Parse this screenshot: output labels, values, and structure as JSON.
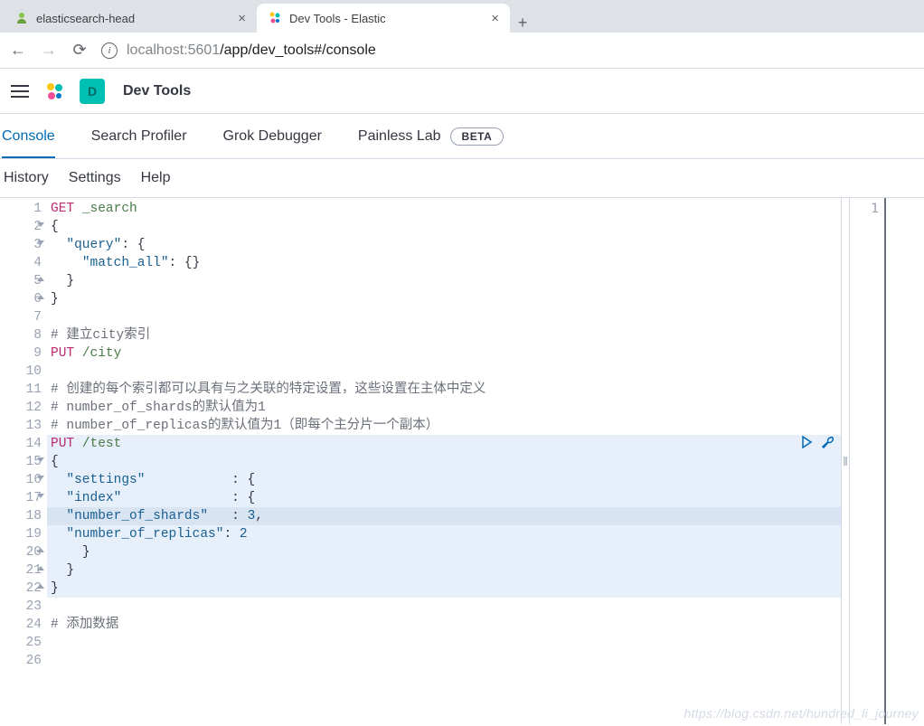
{
  "browser": {
    "tabs": [
      {
        "title": "elasticsearch-head",
        "active": false
      },
      {
        "title": "Dev Tools - Elastic",
        "active": true
      }
    ],
    "url_host_dim1": "localhost",
    "url_port": ":5601",
    "url_path": "/app/dev_tools#/console"
  },
  "header": {
    "user_initial": "D",
    "app_title": "Dev Tools"
  },
  "devtools_tabs": {
    "console": "Console",
    "profiler": "Search Profiler",
    "grok": "Grok Debugger",
    "painless": "Painless Lab",
    "beta": "BETA"
  },
  "subbar": {
    "history": "History",
    "settings": "Settings",
    "help": "Help"
  },
  "editor": {
    "lines": [
      {
        "n": "1",
        "fold": "",
        "tokens": [
          [
            "method",
            "GET"
          ],
          [
            "text",
            " "
          ],
          [
            "path",
            "_search"
          ]
        ]
      },
      {
        "n": "2",
        "fold": "open",
        "tokens": [
          [
            "punc",
            "{"
          ]
        ]
      },
      {
        "n": "3",
        "fold": "open",
        "tokens": [
          [
            "text",
            "  "
          ],
          [
            "key",
            "\"query\""
          ],
          [
            "punc",
            ": {"
          ]
        ]
      },
      {
        "n": "4",
        "fold": "",
        "tokens": [
          [
            "text",
            "    "
          ],
          [
            "key",
            "\"match_all\""
          ],
          [
            "punc",
            ": {}"
          ]
        ]
      },
      {
        "n": "5",
        "fold": "close",
        "tokens": [
          [
            "text",
            "  "
          ],
          [
            "punc",
            "}"
          ]
        ]
      },
      {
        "n": "6",
        "fold": "close",
        "tokens": [
          [
            "punc",
            "}"
          ]
        ]
      },
      {
        "n": "7",
        "fold": "",
        "tokens": []
      },
      {
        "n": "8",
        "fold": "",
        "tokens": [
          [
            "comment",
            "# 建立city索引"
          ]
        ]
      },
      {
        "n": "9",
        "fold": "",
        "tokens": [
          [
            "method",
            "PUT"
          ],
          [
            "text",
            " "
          ],
          [
            "path",
            "/city"
          ]
        ]
      },
      {
        "n": "10",
        "fold": "",
        "tokens": []
      },
      {
        "n": "11",
        "fold": "",
        "tokens": [
          [
            "comment",
            "# 创建的每个索引都可以具有与之关联的特定设置，这些设置在主体中定义"
          ]
        ]
      },
      {
        "n": "12",
        "fold": "",
        "tokens": [
          [
            "comment",
            "# number_of_shards的默认值为1"
          ]
        ]
      },
      {
        "n": "13",
        "fold": "",
        "tokens": [
          [
            "comment",
            "# number_of_replicas的默认值为1（即每个主分片一个副本）"
          ]
        ]
      },
      {
        "n": "14",
        "fold": "",
        "tokens": [
          [
            "method",
            "PUT"
          ],
          [
            "text",
            " "
          ],
          [
            "path",
            "/test"
          ]
        ]
      },
      {
        "n": "15",
        "fold": "open",
        "tokens": [
          [
            "punc",
            "{"
          ]
        ]
      },
      {
        "n": "16",
        "fold": "open",
        "tokens": [
          [
            "text",
            "  "
          ],
          [
            "key",
            "\"settings\""
          ],
          [
            "text",
            "           "
          ],
          [
            "punc",
            ": {"
          ]
        ]
      },
      {
        "n": "17",
        "fold": "open",
        "tokens": [
          [
            "text",
            "  "
          ],
          [
            "key",
            "\"index\""
          ],
          [
            "text",
            "              "
          ],
          [
            "punc",
            ": {"
          ]
        ]
      },
      {
        "n": "18",
        "fold": "",
        "tokens": [
          [
            "text",
            "  "
          ],
          [
            "key",
            "\"number_of_shards\""
          ],
          [
            "text",
            "   "
          ],
          [
            "punc",
            ": "
          ],
          [
            "num",
            "3"
          ],
          [
            "punc",
            ","
          ]
        ]
      },
      {
        "n": "19",
        "fold": "",
        "tokens": [
          [
            "text",
            "  "
          ],
          [
            "key",
            "\"number_of_replicas\""
          ],
          [
            "punc",
            ": "
          ],
          [
            "num",
            "2"
          ]
        ]
      },
      {
        "n": "20",
        "fold": "close",
        "tokens": [
          [
            "text",
            "    "
          ],
          [
            "punc",
            "}"
          ]
        ]
      },
      {
        "n": "21",
        "fold": "close",
        "tokens": [
          [
            "text",
            "  "
          ],
          [
            "punc",
            "}"
          ]
        ]
      },
      {
        "n": "22",
        "fold": "close",
        "tokens": [
          [
            "punc",
            "}"
          ]
        ]
      },
      {
        "n": "23",
        "fold": "",
        "tokens": []
      },
      {
        "n": "24",
        "fold": "",
        "tokens": [
          [
            "comment",
            "# 添加数据"
          ]
        ]
      },
      {
        "n": "25",
        "fold": "",
        "tokens": []
      },
      {
        "n": "26",
        "fold": "",
        "tokens": []
      }
    ],
    "highlight_block": {
      "start": 14,
      "end": 22
    },
    "highlight_line": 18,
    "actions_at_line": 14
  },
  "output": {
    "line1": "1"
  },
  "watermark": "https://blog.csdn.net/hundred_li_journey"
}
